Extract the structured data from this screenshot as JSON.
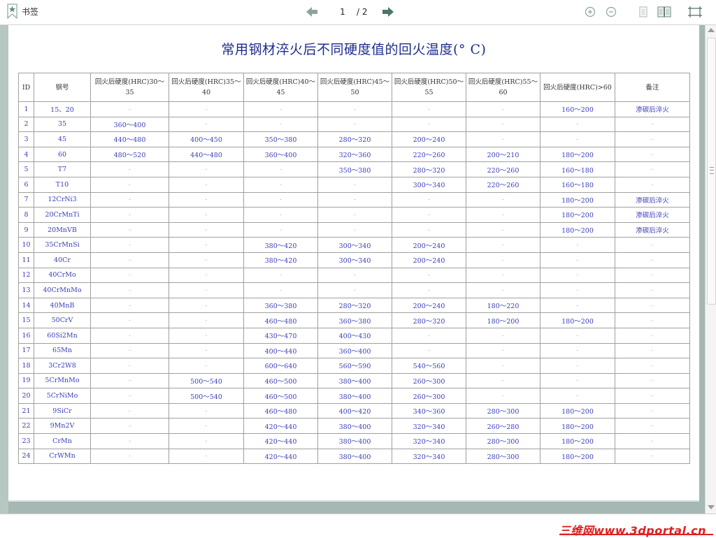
{
  "toolbar": {
    "bookmarks_label": "书签",
    "current_page": "1",
    "total_pages": "/ 2"
  },
  "document": {
    "title": "常用钢材淬火后不同硬度值的回火温度(° C)",
    "headers": [
      "ID",
      "钢号",
      "回火后硬度(HRC)30～35",
      "回火后硬度(HRC)35～40",
      "回火后硬度(HRC)40～45",
      "回火后硬度(HRC)45～50",
      "回火后硬度(HRC)50～55",
      "回火后硬度(HRC)55～60",
      "回火后硬度(HRC)>60",
      "备注"
    ],
    "rows": [
      [
        "1",
        "15、20",
        "-",
        "-",
        "-",
        "-",
        "-",
        "-",
        "160～200",
        "渗碳后淬火"
      ],
      [
        "2",
        "35",
        "360～400",
        "-",
        "-",
        "-",
        "-",
        "-",
        "-",
        "-"
      ],
      [
        "3",
        "45",
        "440～480",
        "400～450",
        "350～380",
        "280～320",
        "200～240",
        "-",
        "-",
        "-"
      ],
      [
        "4",
        "60",
        "480～520",
        "440～480",
        "360～400",
        "320～360",
        "220～260",
        "200～210",
        "180～200",
        "-"
      ],
      [
        "5",
        "T7",
        "-",
        "-",
        "-",
        "350～380",
        "280～320",
        "220～260",
        "160～180",
        "-"
      ],
      [
        "6",
        "T10",
        "-",
        "-",
        "-",
        "-",
        "300～340",
        "220～260",
        "160～180",
        "-"
      ],
      [
        "7",
        "12CrNi3",
        "-",
        "-",
        "-",
        "-",
        "-",
        "-",
        "180～200",
        "渗碳后淬火"
      ],
      [
        "8",
        "20CrMnTi",
        "-",
        "-",
        "-",
        "-",
        "-",
        "-",
        "180～200",
        "渗碳后淬火"
      ],
      [
        "9",
        "20MnVB",
        "-",
        "-",
        "-",
        "-",
        "-",
        "-",
        "180～200",
        "渗碳后淬火"
      ],
      [
        "10",
        "35CrMnSi",
        "-",
        "-",
        "380～420",
        "300～340",
        "200～240",
        "-",
        "-",
        "-"
      ],
      [
        "11",
        "40Cr",
        "-",
        "-",
        "380～420",
        "300～340",
        "200～240",
        "-",
        "-",
        "-"
      ],
      [
        "12",
        "40CrMo",
        "-",
        "-",
        "-",
        "-",
        "-",
        "-",
        "-",
        "-"
      ],
      [
        "13",
        "40CrMnMo",
        "-",
        "-",
        "-",
        "-",
        "-",
        "-",
        "-",
        "-"
      ],
      [
        "14",
        "40MnB",
        "-",
        "-",
        "360～380",
        "280～320",
        "200～240",
        "180～220",
        "-",
        "-"
      ],
      [
        "15",
        "50CrV",
        "-",
        "-",
        "460～480",
        "360～380",
        "280～320",
        "180～200",
        "180～200",
        "-"
      ],
      [
        "16",
        "60Si2Mn",
        "-",
        "-",
        "430～470",
        "400～430",
        "-",
        "-",
        "-",
        "-"
      ],
      [
        "17",
        "65Mn",
        "-",
        "-",
        "400～440",
        "360～400",
        "-",
        "-",
        "-",
        "-"
      ],
      [
        "18",
        "3Cr2W8",
        "-",
        "-",
        "600～640",
        "560～590",
        "540～560",
        "-",
        "-",
        "-"
      ],
      [
        "19",
        "5CrMnMo",
        "-",
        "500～540",
        "460～500",
        "380～400",
        "260～300",
        "-",
        "-",
        "-"
      ],
      [
        "20",
        "5CrNiMo",
        "-",
        "500～540",
        "460～500",
        "380～400",
        "260～300",
        "-",
        "-",
        "-"
      ],
      [
        "21",
        "9SiCr",
        "-",
        "-",
        "460～480",
        "400～420",
        "340～360",
        "280～300",
        "180～200",
        "-"
      ],
      [
        "22",
        "9Mn2V",
        "-",
        "-",
        "420～440",
        "380～400",
        "320～340",
        "260～280",
        "180～200",
        "-"
      ],
      [
        "23",
        "CrMn",
        "-",
        "-",
        "420～440",
        "380～400",
        "320～340",
        "280～300",
        "180～200",
        "-"
      ],
      [
        "24",
        "CrWMn",
        "-",
        "-",
        "420～440",
        "380～400",
        "320～340",
        "280～300",
        "180～200",
        "-"
      ]
    ]
  },
  "watermark": "三维网www.3dportal.cn",
  "colors": {
    "text_blue": "#3a3fb8",
    "title_blue": "#1e2c8c",
    "nav_arrow": "#557a6f",
    "viewer_bg": "#a6b8b3"
  }
}
